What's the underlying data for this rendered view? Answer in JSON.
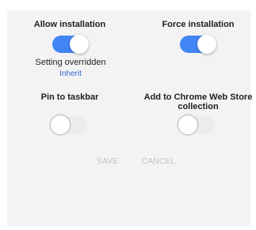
{
  "settings": {
    "allow_installation": {
      "label": "Allow installation",
      "state": "on",
      "note": "Setting overridden",
      "link": "Inherit"
    },
    "force_installation": {
      "label": "Force installation",
      "state": "on"
    },
    "pin_to_taskbar": {
      "label": "Pin to taskbar",
      "state": "off"
    },
    "add_to_collection": {
      "label_line1": "Add to Chrome Web Store",
      "label_line2": "collection",
      "state": "off"
    }
  },
  "actions": {
    "save": "SAVE",
    "cancel": "CANCEL"
  },
  "colors": {
    "toggle_on": "#4285f4",
    "link": "#3367d6",
    "disabled_button": "#c2c2c2"
  }
}
